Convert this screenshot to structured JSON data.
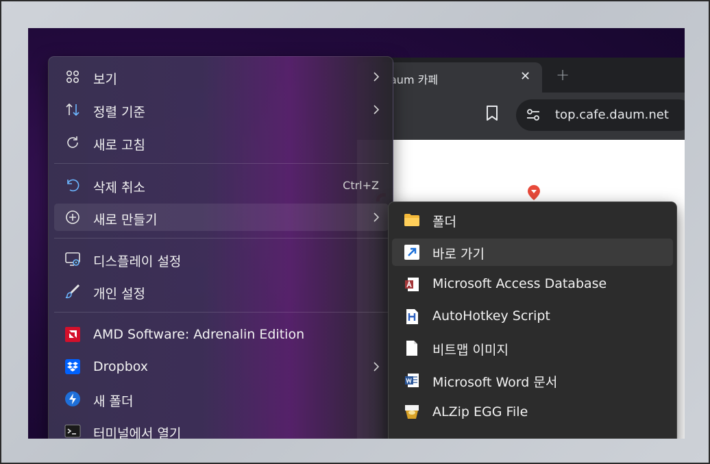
{
  "browser": {
    "tab_title": "aum 카페",
    "tab_close": "✕",
    "new_tab": "+",
    "url": "top.cafe.daum.net"
  },
  "context_menu": {
    "items": [
      {
        "label": "보기",
        "icon": "grid-icon",
        "has_submenu": true
      },
      {
        "label": "정렬 기준",
        "icon": "sort-icon",
        "has_submenu": true
      },
      {
        "label": "새로 고침",
        "icon": "refresh-icon",
        "has_submenu": false
      },
      {
        "label": "삭제 취소",
        "icon": "undo-icon",
        "shortcut": "Ctrl+Z"
      },
      {
        "label": "새로 만들기",
        "icon": "plus-circle-icon",
        "has_submenu": true
      },
      {
        "label": "디스플레이 설정",
        "icon": "display-settings-icon"
      },
      {
        "label": "개인 설정",
        "icon": "brush-icon"
      },
      {
        "label": "AMD Software: Adrenalin Edition",
        "icon": "amd-icon"
      },
      {
        "label": "Dropbox",
        "icon": "dropbox-icon",
        "has_submenu": true
      },
      {
        "label": "새 폴더",
        "icon": "new-folder-app-icon"
      },
      {
        "label": "터미널에서 열기",
        "icon": "terminal-icon"
      }
    ]
  },
  "new_submenu": {
    "items": [
      {
        "label": "폴더",
        "icon": "folder-icon"
      },
      {
        "label": "바로 가기",
        "icon": "shortcut-icon"
      },
      {
        "label": "Microsoft Access Database",
        "icon": "access-icon"
      },
      {
        "label": "AutoHotkey Script",
        "icon": "autohotkey-icon"
      },
      {
        "label": "비트맵 이미지",
        "icon": "bitmap-file-icon"
      },
      {
        "label": "Microsoft Word 문서",
        "icon": "word-icon"
      },
      {
        "label": "ALZip EGG File",
        "icon": "alzip-egg-icon"
      }
    ]
  }
}
